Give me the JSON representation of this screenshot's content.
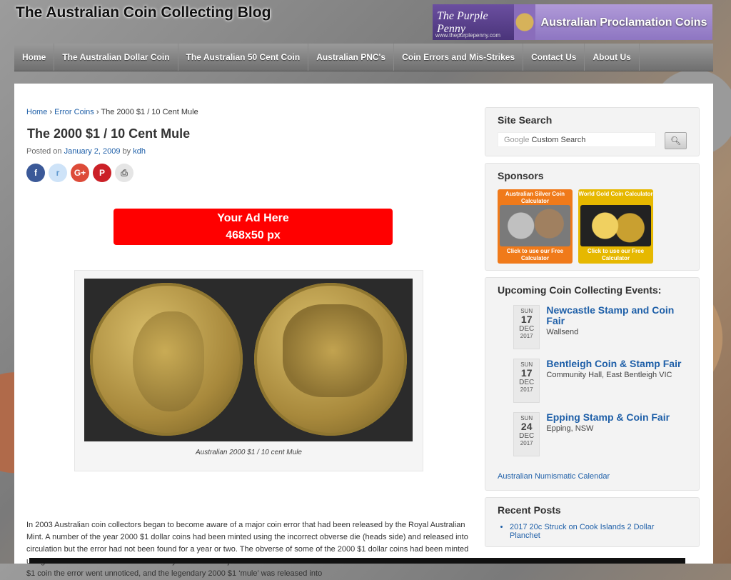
{
  "site": {
    "title": "The Australian Coin Collecting Blog",
    "banner": {
      "logo_text": "The Purple Penny",
      "logo_url": "www.thepurplepenny.com",
      "text": "Australian Proclamation Coins"
    }
  },
  "nav": [
    "Home",
    "The Australian Dollar Coin",
    "The Australian 50 Cent Coin",
    "Australian PNC's",
    "Coin Errors and Mis-Strikes",
    "Contact Us",
    "About Us"
  ],
  "breadcrumb": {
    "home": "Home",
    "sep": "›",
    "category": "Error Coins",
    "current": "The 2000 $1 / 10 Cent Mule"
  },
  "post": {
    "title": "The 2000 $1 / 10 Cent Mule",
    "posted_prefix": "Posted on",
    "date": "January 2, 2009",
    "by": "by",
    "author": "kdh",
    "share": [
      "f",
      "r",
      "G+",
      "P",
      "⎙"
    ],
    "ad_line1": "Your Ad Here",
    "ad_line2": "468x50 px",
    "caption": "Australian 2000 $1 / 10 cent Mule",
    "paragraph": "In 2003 Australian coin collectors began to become aware of a major coin error that had been released by the Royal Australian Mint. A number of the year 2000 $1 dollar coins had been minted using the incorrect obverse die (heads side) and released into circulation but the error had not been found for a year or two. The obverse of some of the 2000 $1 dollar coins had been minted using the Australian 10 cent obverse die by mistake. With just a 1.4 millimetre difference in diameter between the 10 cent and $1 coin the error went unnoticed, and the legendary 2000 $1 ‘mule’ was released into"
  },
  "sidebar": {
    "search": {
      "title": "Site Search",
      "placeholder_brand": "Google",
      "placeholder": "Custom Search",
      "button_icon": "search-icon"
    },
    "sponsors": {
      "title": "Sponsors",
      "items": [
        {
          "top": "Australian Silver Coin Calculator",
          "bottom": "Click to use our Free Calculator",
          "color": "#f07a1a"
        },
        {
          "top": "World Gold Coin Calculator",
          "bottom": "Click to use our Free Calculator",
          "color": "#e6b800"
        }
      ]
    },
    "events": {
      "title": "Upcoming Coin Collecting Events:",
      "items": [
        {
          "dow": "SUN",
          "day": "17",
          "month": "DEC",
          "year": "2017",
          "title": "Newcastle Stamp and Coin Fair",
          "location": "Wallsend"
        },
        {
          "dow": "SUN",
          "day": "17",
          "month": "DEC",
          "year": "2017",
          "title": "Bentleigh Coin & Stamp Fair",
          "location": "Community Hall, East Bentleigh VIC"
        },
        {
          "dow": "SUN",
          "day": "24",
          "month": "DEC",
          "year": "2017",
          "title": "Epping Stamp & Coin Fair",
          "location": "Epping, NSW"
        }
      ],
      "calendar_link": "Australian Numismatic Calendar"
    },
    "recent": {
      "title": "Recent Posts",
      "items": [
        "2017 20c Struck on Cook Islands 2 Dollar Planchet"
      ]
    }
  }
}
